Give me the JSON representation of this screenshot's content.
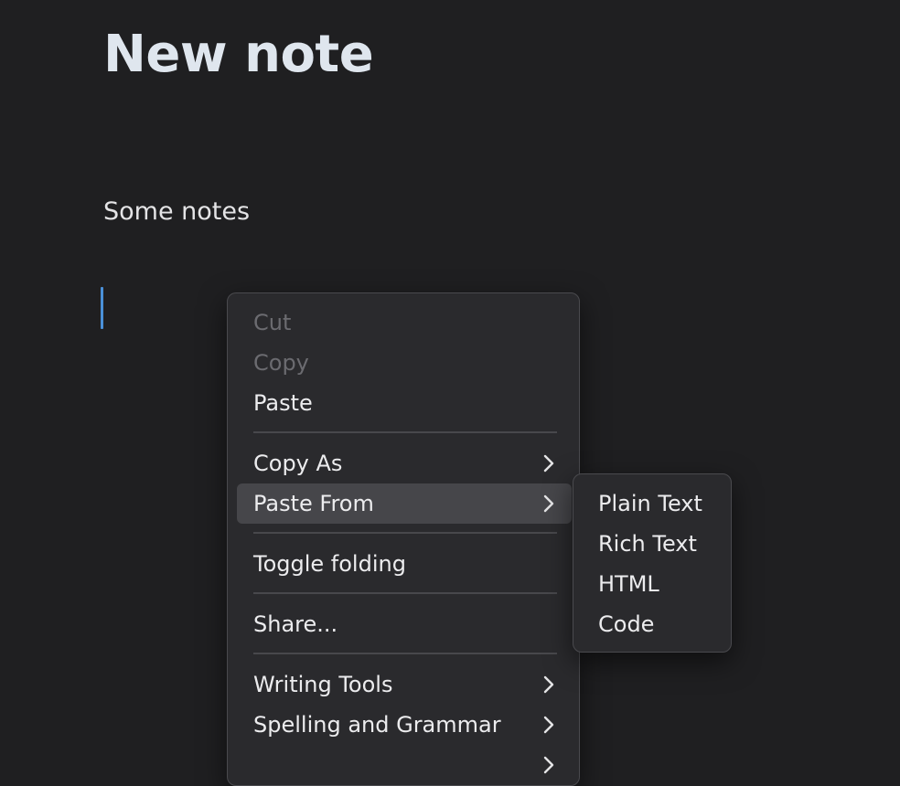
{
  "note": {
    "title": "New note",
    "body": "Some notes"
  },
  "context_menu": {
    "items": [
      {
        "label": "Cut",
        "enabled": false
      },
      {
        "label": "Copy",
        "enabled": false
      },
      {
        "label": "Paste",
        "enabled": true
      },
      {
        "label": "Copy As",
        "enabled": true,
        "submenu": true
      },
      {
        "label": "Paste From",
        "enabled": true,
        "submenu": true,
        "highlighted": true
      },
      {
        "label": "Toggle folding",
        "enabled": true
      },
      {
        "label": "Share...",
        "enabled": true
      },
      {
        "label": "Writing Tools",
        "enabled": true,
        "submenu": true
      },
      {
        "label": "Spelling and Grammar",
        "enabled": true,
        "submenu": true
      }
    ]
  },
  "paste_from_submenu": {
    "items": [
      {
        "label": "Plain Text"
      },
      {
        "label": "Rich Text"
      },
      {
        "label": "HTML"
      },
      {
        "label": "Code"
      }
    ]
  },
  "colors": {
    "background": "#1f1f21",
    "caret": "#4a90d9",
    "menu_background": "#2a2a2d",
    "menu_highlight": "#46464a",
    "disabled_text": "#6b6b70"
  }
}
